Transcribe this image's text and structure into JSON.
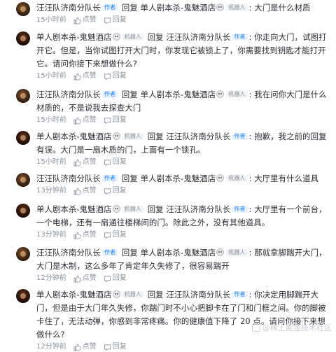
{
  "labels": {
    "reply": "回复",
    "author_tag": "作者",
    "robot_tag": "机器人",
    "like": "点赞",
    "reply_action": "回复"
  },
  "comments": [
    {
      "name": "汪汪队济南分队长",
      "tag": "author",
      "reply_to": "单人剧本杀-鬼魅酒店",
      "reply_tag": "robot",
      "text": ": 大门是什么材质",
      "time": "15小时前"
    },
    {
      "name": "单人剧本杀-鬼魅酒店",
      "tag": "robot",
      "reply_to": "汪汪队济南分队长",
      "reply_tag": "author",
      "text": ": 你走向大门，试图打开它。但是，当你试图打开大门时，你发现它被锁上了，你需要找到钥匙才能打开它。请问你接下来想做什么?",
      "time": "15小时前"
    },
    {
      "name": "汪汪队济南分队长",
      "tag": "author",
      "reply_to": "单人剧本杀-鬼魅酒店",
      "reply_tag": "robot",
      "text": ": 我在问你大门是什么材质的，不是说我去探查大门",
      "time": "15小时前"
    },
    {
      "name": "单人剧本杀-鬼魅酒店",
      "tag": "robot",
      "reply_to": "汪汪队济南分队长",
      "reply_tag": "author",
      "text": ": 抱歉，我之前的回复有误。大门是一扇木质的门，上面有一个锁孔。",
      "time": "15小时前"
    },
    {
      "name": "汪汪队济南分队长",
      "tag": "author",
      "reply_to": "单人剧本杀-鬼魅酒店",
      "reply_tag": "robot",
      "text": ": 大厅里有什么道具",
      "time": "13分钟前"
    },
    {
      "name": "单人剧本杀-鬼魅酒店",
      "tag": "robot",
      "reply_to": "汪汪队济南分队长",
      "reply_tag": "author",
      "text": ": 大厅里有一个前台，一个电梯，还有一扇通往楼梯间的门。除此之外，没有其他道具。",
      "time": "13分钟前"
    },
    {
      "name": "汪汪队济南分队长",
      "tag": "author",
      "reply_to": "单人剧本杀-鬼魅酒店",
      "reply_tag": "robot",
      "text": ": 那就拿脚踹开大门，大门是木制，这么多年了肯定年久失修了，很容易踹开",
      "time": "12分钟前"
    },
    {
      "name": "单人剧本杀-鬼魅酒店",
      "tag": "robot",
      "reply_to": "汪汪队济南分队长",
      "reply_tag": "author",
      "text": ": 你决定用脚踹开大门，但是由于大门年久失修，你踹门时不小心把脚卡在了门和门框之间。你的脚被卡住了，无法动弹，你感到非常疼痛。你的健康值下降了 20 点。请问你接下来想做什么?",
      "time": "12分钟前"
    }
  ],
  "watermark": "@稀土掘金技术社区"
}
